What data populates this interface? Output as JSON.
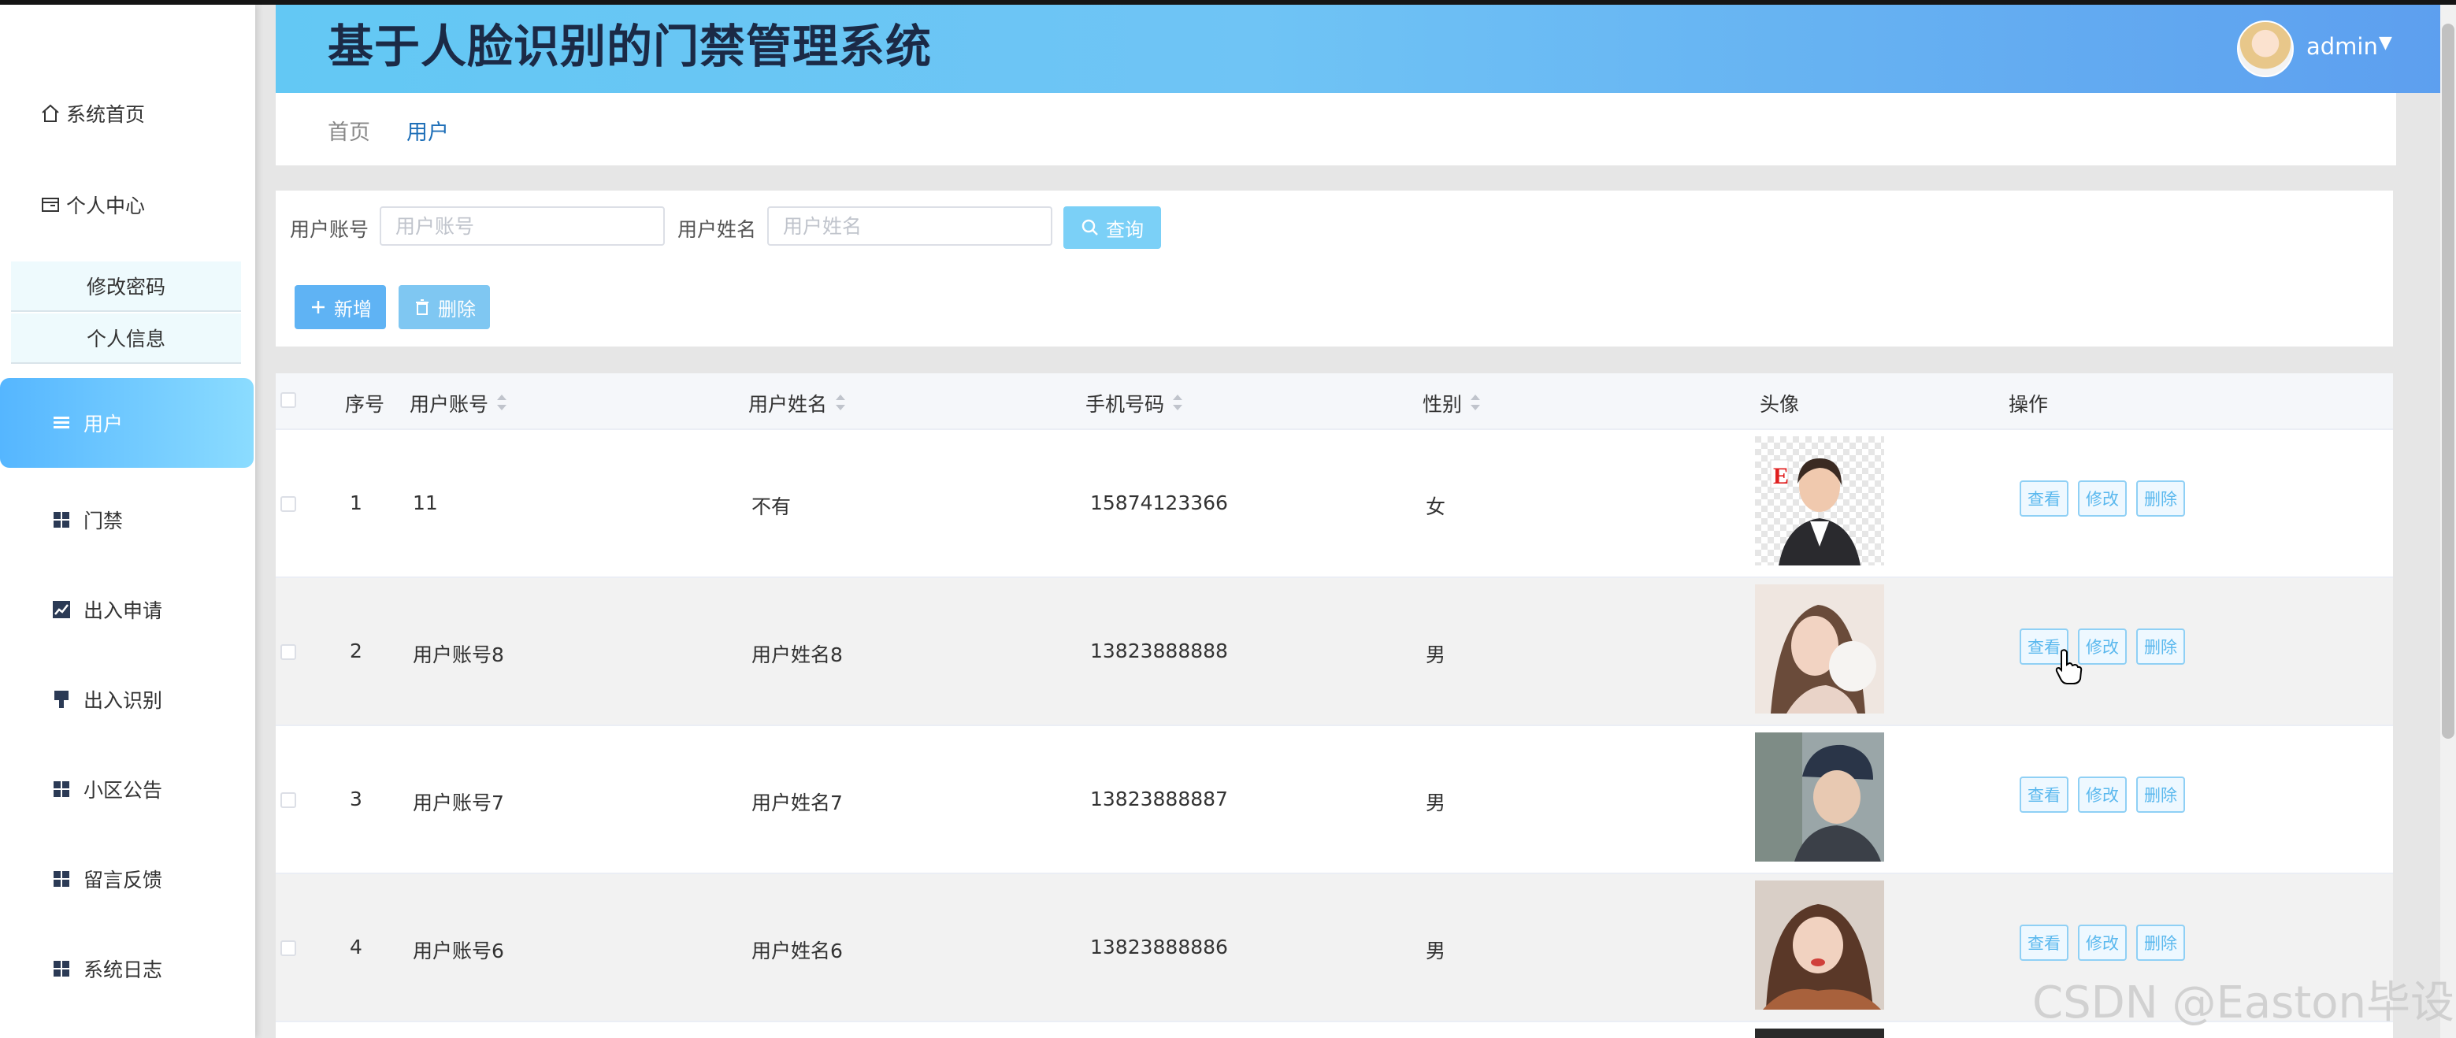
{
  "app": {
    "title": "基于人脸识别的门禁管理系统",
    "user": "admin"
  },
  "colors": {
    "header_start": "#63c8f4",
    "header_end": "#5d9fef",
    "accent": "#55b6ff",
    "active_menu": "#6ccbff",
    "link": "#1e6fb8"
  },
  "sidebar": {
    "items": [
      {
        "label": "系统首页",
        "icon": "home-icon"
      },
      {
        "label": "个人中心",
        "icon": "wallet-icon"
      },
      {
        "label": "用户",
        "icon": "list-icon",
        "active": true
      },
      {
        "label": "门禁",
        "icon": "grid-icon"
      },
      {
        "label": "出入申请",
        "icon": "chart-icon"
      },
      {
        "label": "出入识别",
        "icon": "pin-icon"
      },
      {
        "label": "小区公告",
        "icon": "grid-icon"
      },
      {
        "label": "留言反馈",
        "icon": "grid-icon"
      },
      {
        "label": "系统日志",
        "icon": "grid-icon"
      }
    ],
    "subitems": [
      "修改密码",
      "个人信息"
    ]
  },
  "breadcrumb": {
    "home": "首页",
    "current": "用户"
  },
  "search": {
    "account_label": "用户账号",
    "account_placeholder": "用户账号",
    "name_label": "用户姓名",
    "name_placeholder": "用户姓名",
    "query_button": "查询"
  },
  "toolbar": {
    "add_button": "新增",
    "delete_button": "删除"
  },
  "table": {
    "columns": {
      "index": "序号",
      "account": "用户账号",
      "name": "用户姓名",
      "phone": "手机号码",
      "gender": "性别",
      "avatar": "头像",
      "actions": "操作"
    },
    "rows": [
      {
        "index": "1",
        "account": "11",
        "name": "不有",
        "phone": "15874123366",
        "gender": "女"
      },
      {
        "index": "2",
        "account": "用户账号8",
        "name": "用户姓名8",
        "phone": "13823888888",
        "gender": "男"
      },
      {
        "index": "3",
        "account": "用户账号7",
        "name": "用户姓名7",
        "phone": "13823888887",
        "gender": "男"
      },
      {
        "index": "4",
        "account": "用户账号6",
        "name": "用户姓名6",
        "phone": "13823888886",
        "gender": "男"
      }
    ],
    "actions": {
      "view": "查看",
      "edit": "修改",
      "delete": "删除"
    }
  },
  "watermark": "CSDN @Easton毕设"
}
